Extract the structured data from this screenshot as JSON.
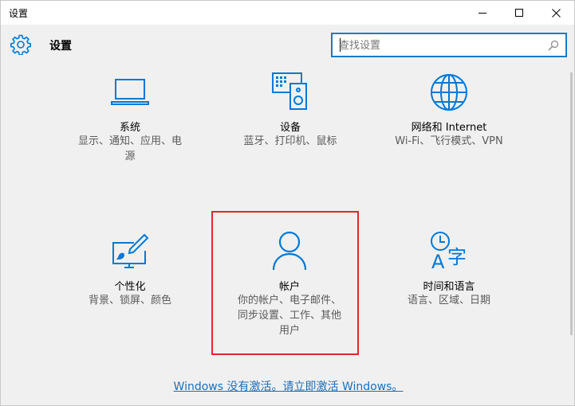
{
  "window": {
    "title": "设置",
    "controls": {
      "minimize": "minimize",
      "maximize": "maximize",
      "close": "close"
    }
  },
  "header": {
    "title": "设置",
    "icon": "gear-icon"
  },
  "search": {
    "placeholder": "查找设置",
    "value": "",
    "icon": "search-icon"
  },
  "tiles": [
    {
      "name": "系统",
      "desc": "显示、通知、应用、电源",
      "icon": "laptop-icon"
    },
    {
      "name": "设备",
      "desc": "蓝牙、打印机、鼠标",
      "icon": "devices-icon"
    },
    {
      "name": "网络和 Internet",
      "desc": "Wi-Fi、飞行模式、VPN",
      "icon": "globe-icon"
    },
    {
      "name": "个性化",
      "desc": "背景、锁屏、颜色",
      "icon": "personalization-icon"
    },
    {
      "name": "帐户",
      "desc": "你的帐户、电子邮件、同步设置、工作、其他用户",
      "icon": "user-icon"
    },
    {
      "name": "时间和语言",
      "desc": "语言、区域、日期",
      "icon": "time-language-icon"
    }
  ],
  "desc_lines": {
    "system": [
      "显示、通知、应用、电",
      "源"
    ],
    "accounts": [
      "你的帐户、电子邮件、",
      "同步设置、工作、其他",
      "用户"
    ]
  },
  "activation": {
    "text": "Windows 没有激活。请立即激活 Windows。"
  },
  "colors": {
    "accent": "#0078d7",
    "highlight_border": "#e0282d",
    "link": "#1d6fb8"
  }
}
